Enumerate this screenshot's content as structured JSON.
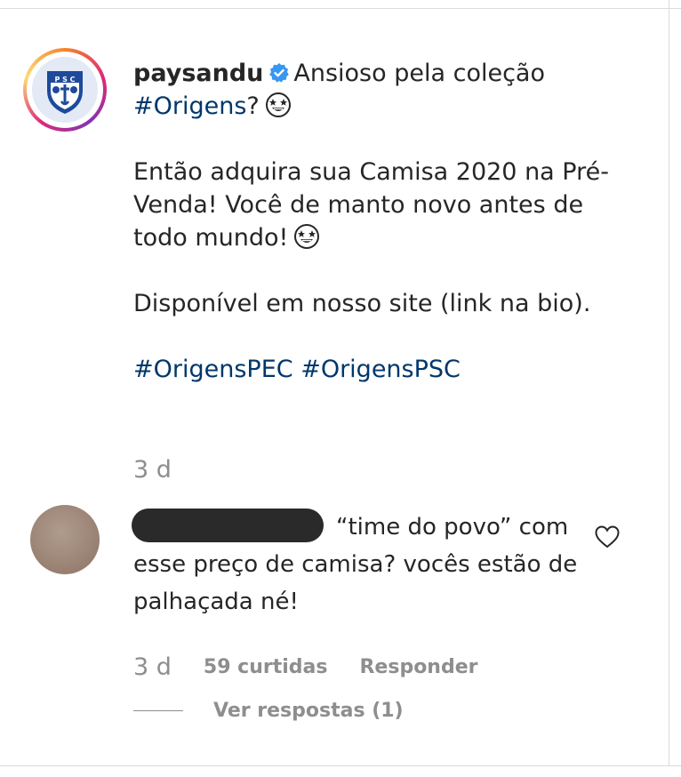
{
  "post": {
    "username": "paysandu",
    "verified_icon": "verified-badge-icon",
    "caption_line1": "Ansioso pela coleção",
    "caption_hashtag1": "#Origens",
    "caption_hashtag1_suffix": "?",
    "emoji1": "star-struck-emoji",
    "caption_para2": "Então adquira sua Camisa 2020 na Pré-Venda! Você de manto novo antes de todo mundo!",
    "emoji2": "star-struck-emoji",
    "caption_para3": "Disponível em nosso site (link na bio).",
    "hashtags": [
      "#OrigensPEC",
      "#OrigensPSC"
    ],
    "time": "3 d"
  },
  "comment": {
    "text": "“time do povo” com esse preço de camisa? vocês estão de palhaçada né!",
    "time": "3 d",
    "likes": "59 curtidas",
    "reply_label": "Responder",
    "view_replies": "Ver respostas (1)",
    "like_icon": "heart-outline-icon"
  },
  "colors": {
    "text": "#262626",
    "muted": "#8e8e8e",
    "hashtag": "#00376b",
    "verified": "#3897f0",
    "club_blue": "#1e4a9a"
  }
}
